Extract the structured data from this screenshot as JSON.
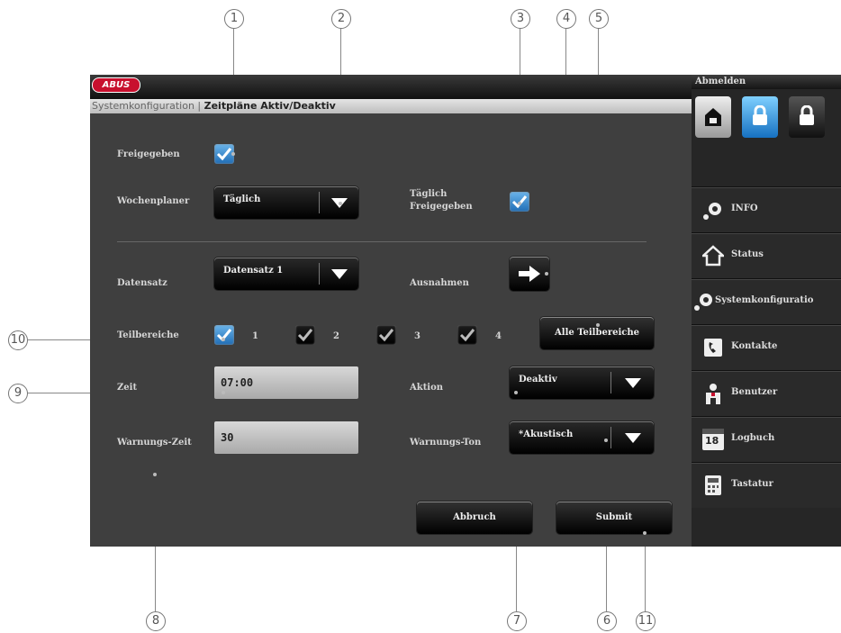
{
  "callouts": [
    "1",
    "2",
    "3",
    "4",
    "5",
    "6",
    "7",
    "8",
    "9",
    "10",
    "11"
  ],
  "logo_text": "ABUS",
  "breadcrumb": {
    "part1": "Systemkonfiguration",
    "separator": " | ",
    "part2": "Zeitpläne Aktiv/Deaktiv"
  },
  "form": {
    "freigegeben_label": "Freigegeben",
    "wochenplaner_label": "Wochenplaner",
    "wochenplaner_value": "Täglich",
    "taeglich_label_line1": "Täglich",
    "taeglich_label_line2": "Freigegeben",
    "datensatz_label": "Datensatz",
    "datensatz_value": "Datensatz 1",
    "ausnahmen_label": "Ausnahmen",
    "teilbereiche_label": "Teilbereiche",
    "teilbereich_numbers": [
      "1",
      "2",
      "3",
      "4"
    ],
    "alle_teilbereiche_label": "Alle Teilbereiche",
    "zeit_label": "Zeit",
    "zeit_value": "07:00",
    "aktion_label": "Aktion",
    "aktion_value": "Deaktiv",
    "warnungs_zeit_label": "Warnungs-Zeit",
    "warnungs_zeit_value": "30",
    "warnungs_ton_label": "Warnungs-Ton",
    "warnungs_ton_value": "*Akustisch",
    "abbruch_label": "Abbruch",
    "submit_label": "Submit"
  },
  "sidebar": {
    "header": "Abmelden",
    "items": [
      {
        "label": "INFO",
        "icon": "gear-icon"
      },
      {
        "label": "Status",
        "icon": "house-icon"
      },
      {
        "label": "Systemkonfiguratio",
        "icon": "gears-icon"
      },
      {
        "label": "Kontakte",
        "icon": "phone-book-icon"
      },
      {
        "label": "Benutzer",
        "icon": "user-icon"
      },
      {
        "label": "Logbuch",
        "icon": "calendar-icon"
      },
      {
        "label": "Tastatur",
        "icon": "keypad-icon"
      }
    ],
    "calendar_number": "18"
  },
  "colors": {
    "accent": "#1f6db6",
    "logo": "#c8102e",
    "panel": "#3f3f3f"
  }
}
